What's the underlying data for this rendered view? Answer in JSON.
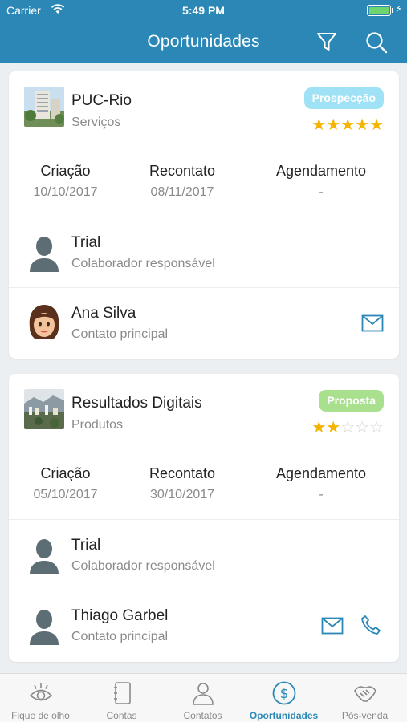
{
  "status": {
    "carrier": "Carrier",
    "time": "5:49 PM"
  },
  "header": {
    "title": "Oportunidades"
  },
  "opportunities": [
    {
      "name": "PUC-Rio",
      "category": "Serviços",
      "stage": "Prospecção",
      "stage_color": "#9fe2f5",
      "rating": 5,
      "rating_max": 5,
      "dates": [
        {
          "label": "Criação",
          "value": "10/10/2017"
        },
        {
          "label": "Recontato",
          "value": "08/11/2017"
        },
        {
          "label": "Agendamento",
          "value": "-"
        }
      ],
      "owner": {
        "name": "Trial",
        "role": "Colaborador responsável"
      },
      "contact": {
        "name": "Ana Silva",
        "role": "Contato principal"
      }
    },
    {
      "name": "Resultados Digitais",
      "category": "Produtos",
      "stage": "Proposta",
      "stage_color": "#a8e08e",
      "rating": 2,
      "rating_max": 5,
      "dates": [
        {
          "label": "Criação",
          "value": "05/10/2017"
        },
        {
          "label": "Recontato",
          "value": "30/10/2017"
        },
        {
          "label": "Agendamento",
          "value": "-"
        }
      ],
      "owner": {
        "name": "Trial",
        "role": "Colaborador responsável"
      },
      "contact": {
        "name": "Thiago Garbel",
        "role": "Contato principal"
      }
    }
  ],
  "tabs": [
    {
      "label": "Fique de olho",
      "icon": "eye-icon"
    },
    {
      "label": "Contas",
      "icon": "notebook-icon"
    },
    {
      "label": "Contatos",
      "icon": "person-icon"
    },
    {
      "label": "Oportunidades",
      "icon": "dollar-icon",
      "active": true
    },
    {
      "label": "Pós-venda",
      "icon": "handshake-icon"
    }
  ],
  "colors": {
    "header": "#2b88b6",
    "accent": "#2b88b6",
    "star": "#f4b400"
  }
}
